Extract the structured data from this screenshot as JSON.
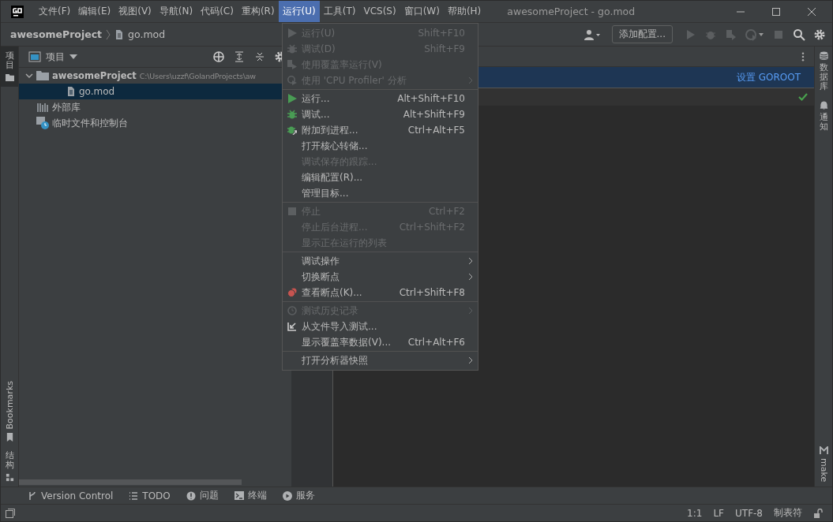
{
  "window": {
    "title": "awesomeProject - go.mod"
  },
  "menu_bar": [
    {
      "label": "文件(F)",
      "selected": false
    },
    {
      "label": "编辑(E)",
      "selected": false
    },
    {
      "label": "视图(V)",
      "selected": false
    },
    {
      "label": "导航(N)",
      "selected": false
    },
    {
      "label": "代码(C)",
      "selected": false
    },
    {
      "label": "重构(R)",
      "selected": false
    },
    {
      "label": "运行(U)",
      "selected": true
    },
    {
      "label": "工具(T)",
      "selected": false
    },
    {
      "label": "VCS(S)",
      "selected": false
    },
    {
      "label": "窗口(W)",
      "selected": false
    },
    {
      "label": "帮助(H)",
      "selected": false
    }
  ],
  "breadcrumbs": [
    {
      "kind": "project",
      "label": "awesomeProject"
    },
    {
      "kind": "file",
      "label": "go.mod"
    }
  ],
  "toolbar": {
    "config_button": "添加配置..."
  },
  "left_stripe": [
    {
      "kind": "project",
      "label": "项目",
      "selected": true
    },
    {
      "kind": "bookmarks",
      "label": "Bookmarks",
      "selected": false
    },
    {
      "kind": "structure",
      "label": "结构",
      "selected": false
    }
  ],
  "right_stripe": [
    {
      "kind": "database",
      "label": "数据库"
    },
    {
      "kind": "notifications",
      "label": "通知"
    },
    {
      "kind": "make",
      "label": "make"
    }
  ],
  "project_panel": {
    "title": "项目",
    "tree": [
      {
        "kind": "folder",
        "label": "awesomeProject",
        "path": "C:\\Users\\uzzf\\GolandProjects\\aw",
        "expanded": true,
        "selected": false,
        "children": [
          {
            "kind": "file",
            "label": "go.mod",
            "selected": true
          }
        ]
      },
      {
        "kind": "library",
        "label": "外部库",
        "selected": false
      },
      {
        "kind": "scratch",
        "label": "临时文件和控制台",
        "selected": false
      }
    ]
  },
  "editor": {
    "banner_link": "设置 GOROOT"
  },
  "run_menu": [
    {
      "kind": "run",
      "label": "运行(U)",
      "shortcut": "Shift+F10",
      "disabled": true,
      "submenu": false
    },
    {
      "kind": "debug",
      "label": "调试(D)",
      "shortcut": "Shift+F9",
      "disabled": true,
      "submenu": false
    },
    {
      "kind": "coverage",
      "label": "使用覆盖率运行(V)",
      "disabled": true,
      "submenu": false
    },
    {
      "kind": "profiler",
      "label": "使用 'CPU Profiler' 分析",
      "disabled": true,
      "submenu": true
    },
    {
      "kind": "separator"
    },
    {
      "kind": "run",
      "label": "运行...",
      "shortcut": "Alt+Shift+F10",
      "disabled": false,
      "submenu": false
    },
    {
      "kind": "debug",
      "label": "调试...",
      "shortcut": "Alt+Shift+F9",
      "disabled": false,
      "submenu": false
    },
    {
      "kind": "attach",
      "label": "附加到进程...",
      "shortcut": "Ctrl+Alt+F5",
      "disabled": false,
      "submenu": false
    },
    {
      "kind": "plain",
      "label": "打开核心转储...",
      "disabled": false,
      "submenu": false
    },
    {
      "kind": "plain",
      "label": "调试保存的跟踪...",
      "disabled": true,
      "submenu": false
    },
    {
      "kind": "plain",
      "label": "编辑配置(R)...",
      "disabled": false,
      "submenu": false
    },
    {
      "kind": "plain",
      "label": "管理目标...",
      "disabled": false,
      "submenu": false
    },
    {
      "kind": "separator"
    },
    {
      "kind": "stop",
      "label": "停止",
      "shortcut": "Ctrl+F2",
      "disabled": true,
      "submenu": false
    },
    {
      "kind": "plain",
      "label": "停止后台进程...",
      "shortcut": "Ctrl+Shift+F2",
      "disabled": true,
      "submenu": false
    },
    {
      "kind": "plain",
      "label": "显示正在运行的列表",
      "disabled": true,
      "submenu": false
    },
    {
      "kind": "separator"
    },
    {
      "kind": "plain",
      "label": "调试操作",
      "disabled": false,
      "submenu": true
    },
    {
      "kind": "plain",
      "label": "切换断点",
      "disabled": false,
      "submenu": true
    },
    {
      "kind": "breakpoints",
      "label": "查看断点(K)...",
      "shortcut": "Ctrl+Shift+F8",
      "disabled": false,
      "submenu": false
    },
    {
      "kind": "separator"
    },
    {
      "kind": "history",
      "label": "测试历史记录",
      "disabled": true,
      "submenu": true
    },
    {
      "kind": "import",
      "label": "从文件导入测试...",
      "disabled": false,
      "submenu": false
    },
    {
      "kind": "plain",
      "label": "显示覆盖率数据(V)...",
      "shortcut": "Ctrl+Alt+F6",
      "disabled": false,
      "submenu": false
    },
    {
      "kind": "separator"
    },
    {
      "kind": "plain",
      "label": "打开分析器快照",
      "disabled": false,
      "submenu": true
    }
  ],
  "tool_windows": [
    {
      "kind": "vcs",
      "label": "Version Control"
    },
    {
      "kind": "todo",
      "label": "TODO"
    },
    {
      "kind": "problems",
      "label": "问题"
    },
    {
      "kind": "terminal",
      "label": "终端"
    },
    {
      "kind": "services",
      "label": "服务"
    }
  ],
  "status_bar": [
    "1:1",
    "LF",
    "UTF-8",
    "制表符"
  ]
}
